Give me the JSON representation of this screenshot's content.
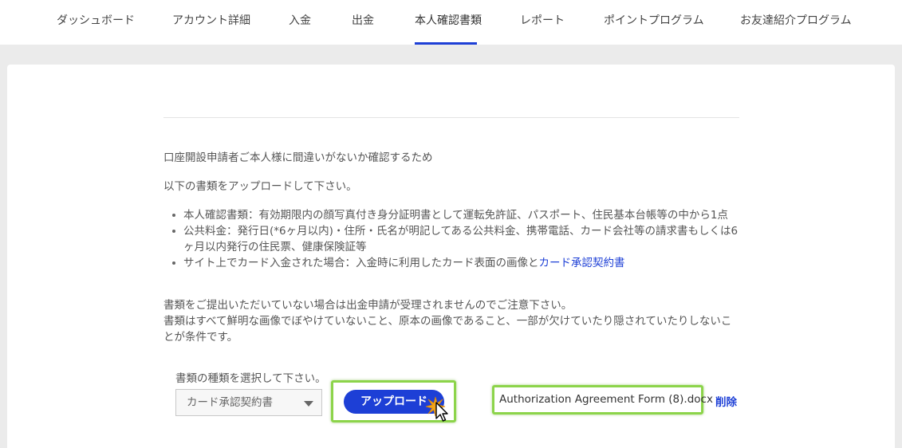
{
  "nav": {
    "tabs": [
      {
        "label": "ダッシュボード"
      },
      {
        "label": "アカウント詳細"
      },
      {
        "label": "入金"
      },
      {
        "label": "出金"
      },
      {
        "label": "本人確認書類"
      },
      {
        "label": "レポート"
      },
      {
        "label": "ポイントプログラム"
      },
      {
        "label": "お友達紹介プログラム"
      }
    ],
    "active_index": 4
  },
  "content": {
    "intro_line1": "口座開設申請者ご本人様に間違いがないか確認するため",
    "intro_line2": "以下の書類をアップロードして下さい。",
    "bullets": [
      {
        "text": "本人確認書類：有効期限内の顔写真付き身分証明書として運転免許証、パスポート、住民基本台帳等の中から1点"
      },
      {
        "text": "公共料金：発行日(*6ヶ月以内)・住所・氏名が明記してある公共料金、携帯電話、カード会社等の請求書もしくは6ヶ月以内発行の住民票、健康保険証等"
      },
      {
        "text": "サイト上でカード入金された場合：入金時に利用したカード表面の画像と",
        "link": "カード承認契約書"
      }
    ],
    "notice_line1": "書類をご提出いただいていない場合は出金申請が受理されませんのでご注意下さい。",
    "notice_line2": "書類はすべて鮮明な画像でぼやけていないこと、原本の画像であること、一部が欠けていたり隠されていたりしないことが条件です。"
  },
  "upload": {
    "select_label": "書類の種類を選択して下さい。",
    "select_value": "カード承認契約書",
    "upload_button": "アップロード",
    "file_name": "Authorization Agreement Form (8).docx",
    "delete_label": "削除"
  },
  "colors": {
    "accent": "#1d3fd6",
    "highlight": "#8cd44a",
    "background": "#ebebeb"
  }
}
